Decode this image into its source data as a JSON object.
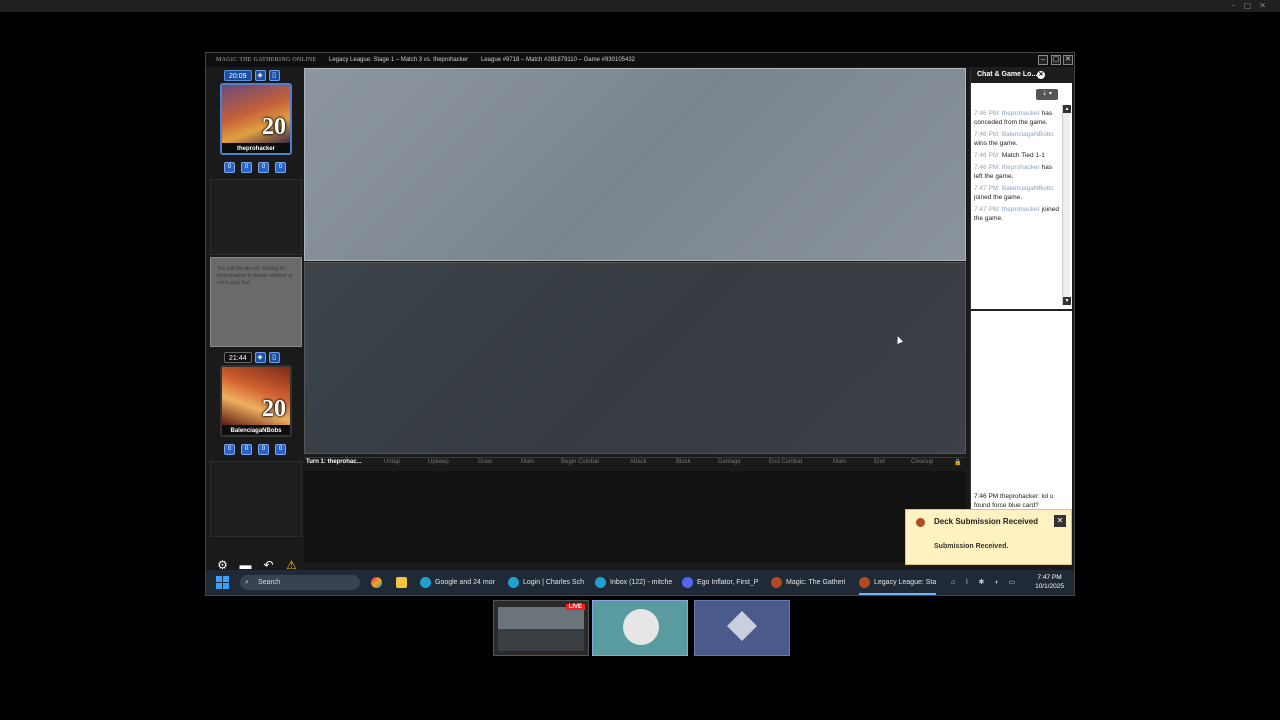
{
  "window": {
    "app_logo": "MAGIC THE GATHERING ONLINE",
    "event": "Legacy League: Stage 1 – Match 3 vs. theprohacker",
    "ids": "League #9718 – Match #281879110 – Game #930105432"
  },
  "opponent": {
    "clock": "20:09",
    "life": "20",
    "name": "theprohacker",
    "counters": [
      "0",
      "0",
      "0",
      "0"
    ]
  },
  "player": {
    "clock": "21:44",
    "life": "20",
    "name": "BalenciagaNBobs",
    "counters": [
      "0",
      "0",
      "0",
      "0"
    ]
  },
  "message": "You lost the die roll. Waiting for theprohacker to decide whether or not to play first.",
  "phases": {
    "turn": "Turn 1: theprohac...",
    "steps": [
      "Untap",
      "Upkeep",
      "Draw",
      "Main",
      "Begin Combat",
      "Attack",
      "Block",
      "Damage",
      "End Combat",
      "Main",
      "End",
      "Cleanup"
    ]
  },
  "chat": {
    "tab_label": "Chat & Game Lo...",
    "entries": [
      {
        "time": "7:46 PM:",
        "user": "theprohacker",
        "text": "has conceded from the game."
      },
      {
        "time": "7:46 PM:",
        "user": "BalenciagaNBobs",
        "text": "wins the game."
      },
      {
        "time": "7:46 PM:",
        "user": "",
        "text": "Match Tied 1-1"
      },
      {
        "time": "7:46 PM:",
        "user": "theprohacker",
        "text": "has left the game."
      },
      {
        "time": "7:47 PM:",
        "user": "BalenciagaNBobs",
        "text": "joined the game."
      },
      {
        "time": "7:47 PM:",
        "user": "theprohacker",
        "text": "joined the game."
      }
    ],
    "last_message": {
      "time": "7:46 PM",
      "user": "theprohacker:",
      "text": "lol u found force blue card?"
    }
  },
  "toast": {
    "title": "Deck Submission Received",
    "body": "Submission Received."
  },
  "taskbar": {
    "search": "Search",
    "items": [
      "Google and 24 mor",
      "Login | Charles Sch",
      "Inbox (122) - mitche",
      "Ego Inflator, First_P",
      "Magic: The Gatheri",
      "Legacy League: Sta"
    ],
    "time": "7:47 PM",
    "date": "10/1/2025"
  },
  "thumbs": {
    "live": "LIVE"
  }
}
